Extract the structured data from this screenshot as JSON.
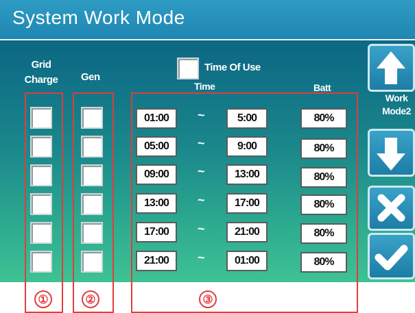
{
  "header": {
    "title": "System Work Mode"
  },
  "columns": {
    "grid_charge": "Grid\nCharge",
    "gen": "Gen",
    "time_of_use": "Time Of Use",
    "time": "Time",
    "batt": "Batt"
  },
  "rows": [
    {
      "start": "01:00",
      "end": "5:00",
      "batt": "80%"
    },
    {
      "start": "05:00",
      "end": "9:00",
      "batt": "80%"
    },
    {
      "start": "09:00",
      "end": "13:00",
      "batt": "80%"
    },
    {
      "start": "13:00",
      "end": "17:00",
      "batt": "80%"
    },
    {
      "start": "17:00",
      "end": "21:00",
      "batt": "80%"
    },
    {
      "start": "21:00",
      "end": "01:00",
      "batt": "80%"
    }
  ],
  "separator": "~",
  "side": {
    "work_mode_label": "Work\nMode2",
    "up_icon": "arrow-up-icon",
    "down_icon": "arrow-down-icon",
    "cancel_icon": "close-icon",
    "confirm_icon": "checkmark-icon"
  },
  "annotations": [
    "①",
    "②",
    "③"
  ],
  "colors": {
    "annotation": "#e23c3c",
    "header": "#2a93bf"
  }
}
